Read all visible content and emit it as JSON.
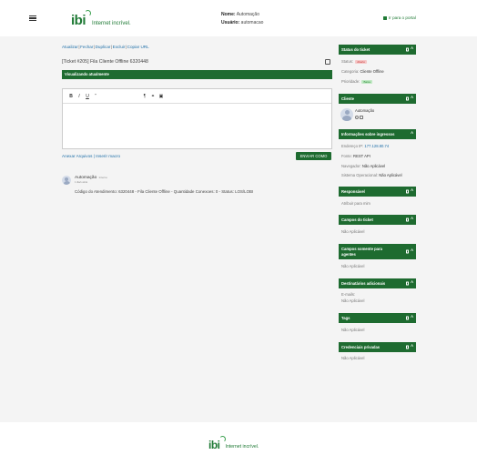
{
  "header": {
    "logo_mark": "ibi",
    "logo_tagline": "Internet incrível.",
    "name_label": "Nome:",
    "name_value": "Automação",
    "user_label": "Usuário:",
    "user_value": "automacao",
    "portal_link": "Ir para o portal"
  },
  "actions": {
    "atualizar": "Atualizar",
    "fechar": "Fechar",
    "duplicar": "Duplicar",
    "excluir": "Excluir",
    "copiar_url": "Copiar URL"
  },
  "ticket": {
    "title": "[Ticket #205] Fila Cliente Offline 6320448",
    "viewing_label": "Visualizando atualmente"
  },
  "editor": {
    "toolbar": [
      "B",
      "I",
      "U",
      "“"
    ],
    "attach_link": "Anexar Arquivos",
    "insert_macro_link": "Inserir macro",
    "send_button": "ENVIAR COMO"
  },
  "message": {
    "author": "Automação",
    "author_tag": "Interno",
    "date": "1 dia/s atrás",
    "text": "Código do Atendimento: 6320448 - Fila Cliente Offline - Quantidade Conexoes: 0 - Status: LOS/LOBI"
  },
  "sidebar": {
    "status_header": "Status do ticket",
    "status_label": "Status:",
    "status_value": "Aberto",
    "category_label": "Categoria:",
    "category_value": "Cliente Offline",
    "priority_label": "Prioridade:",
    "priority_value": "Baixa",
    "client_header": "Cliente",
    "client_name": "Automação",
    "info_header": "Informações sobre ingressos",
    "ip_label": "Endereço IP:",
    "ip_value": "177.128.80.74",
    "source_label": "Fonte:",
    "source_value": "REST API",
    "browser_label": "Navegador:",
    "browser_value": "Não Aplicável",
    "os_label": "Sistema Operacional:",
    "os_value": "Não Aplicável",
    "responsible_header": "Responsável",
    "responsible_value": "Atribuir para mim",
    "fields_header": "Campos do ticket",
    "fields_value": "Não Aplicável",
    "agents_header": "Campos somente para agentes",
    "agents_value": "Não Aplicável",
    "recipients_header": "Destinatários adicionais",
    "email_label": "E-mails:",
    "email_value": "Não Aplicável",
    "tags_header": "Tags",
    "tags_value": "Não Aplicável",
    "credentials_header": "Credenciais privadas",
    "credentials_value": "Não Aplicável"
  },
  "footer": {
    "logo_mark": "ibi",
    "logo_tagline": "Internet incrível."
  },
  "colors": {
    "brand_green": "#1e6b30",
    "link_blue": "#1f6fa8",
    "status_red": "#c73333",
    "priority_green": "#2a8a37"
  }
}
